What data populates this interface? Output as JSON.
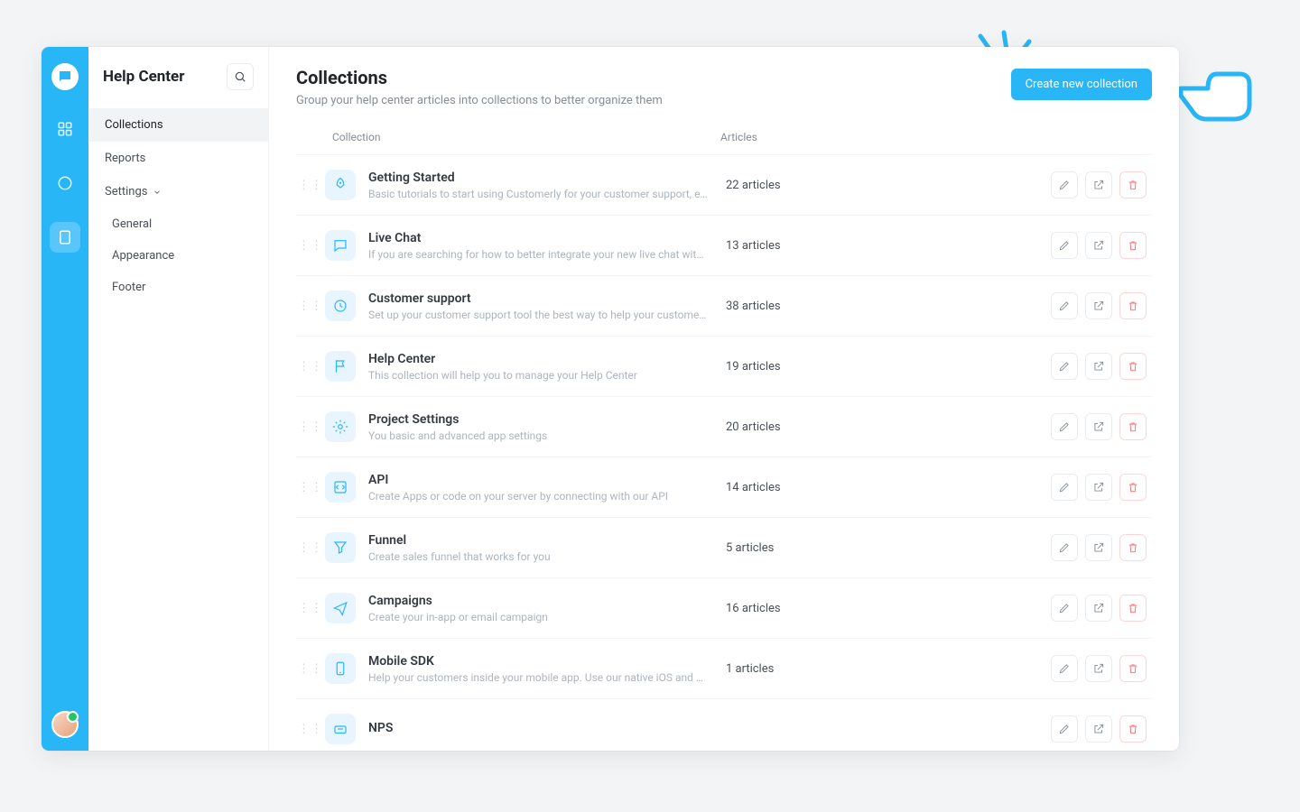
{
  "colors": {
    "accent": "#29B6F6",
    "danger": "#ff6b6b"
  },
  "rail": {
    "items": [
      {
        "name": "dashboard",
        "active": false
      },
      {
        "name": "chat",
        "active": false
      },
      {
        "name": "help-center",
        "active": true
      }
    ]
  },
  "sidebar": {
    "title": "Help Center",
    "nav": [
      {
        "label": "Collections",
        "active": true
      },
      {
        "label": "Reports",
        "active": false
      },
      {
        "label": "Settings",
        "active": false,
        "expandable": true,
        "expanded": true
      }
    ],
    "settings_children": [
      {
        "label": "General"
      },
      {
        "label": "Appearance"
      },
      {
        "label": "Footer"
      }
    ]
  },
  "main": {
    "title": "Collections",
    "subtitle": "Group your help center articles into collections to better organize them",
    "create_button": "Create new collection",
    "columns": {
      "collection": "Collection",
      "articles": "Articles"
    },
    "articles_word": "articles",
    "rows": [
      {
        "icon": "rocket",
        "title": "Getting Started",
        "desc": "Basic tutorials to start using Customerly for your customer support, email funnel and fi",
        "count": 22
      },
      {
        "icon": "chat",
        "title": "Live Chat",
        "desc": "If you are searching for how to better integrate your new live chat with your website, thi",
        "count": 13
      },
      {
        "icon": "support",
        "title": "Customer support",
        "desc": "Set up your customer support tool the best way to help your customers",
        "count": 38
      },
      {
        "icon": "flag",
        "title": "Help Center",
        "desc": "This collection will help you to manage your Help Center",
        "count": 19
      },
      {
        "icon": "settings",
        "title": "Project Settings",
        "desc": "You basic and advanced app settings",
        "count": 20
      },
      {
        "icon": "api",
        "title": "API",
        "desc": "Create Apps or code on your server by connecting with our API",
        "count": 14
      },
      {
        "icon": "funnel",
        "title": "Funnel",
        "desc": "Create sales funnel that works for you",
        "count": 5
      },
      {
        "icon": "send",
        "title": "Campaigns",
        "desc": "Create your in-app or email campaign",
        "count": 16
      },
      {
        "icon": "mobile",
        "title": "Mobile SDK",
        "desc": "Help your customers inside your mobile app. Use our native iOS and Android mobile SD",
        "count": 1
      },
      {
        "icon": "nps",
        "title": "NPS",
        "desc": "",
        "count": null
      }
    ]
  }
}
